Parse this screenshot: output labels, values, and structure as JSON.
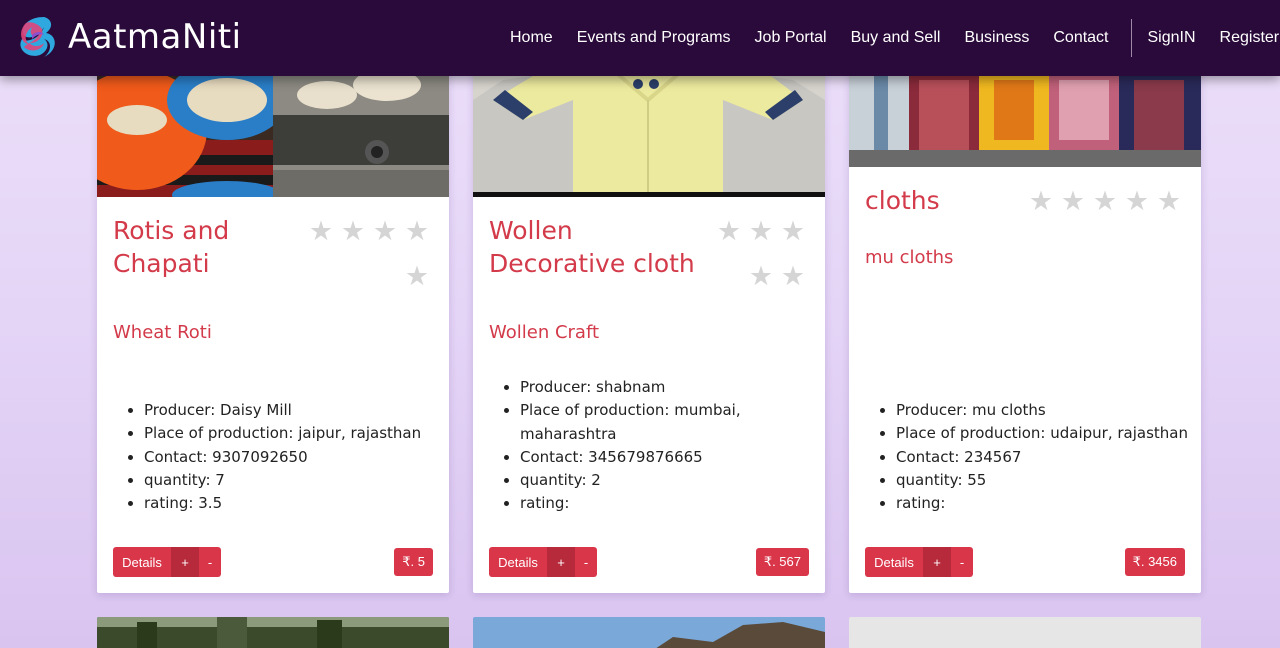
{
  "navbar": {
    "brand": "AatmaNiti",
    "links": [
      "Home",
      "Events and Programs",
      "Job Portal",
      "Buy and Sell",
      "Business",
      "Contact"
    ],
    "auth": [
      "SignIN",
      "Register"
    ]
  },
  "cards": [
    {
      "title_line1": "Rotis and",
      "title_line2": "Chapati",
      "subtitle": "Wheat Roti",
      "producer": "Producer: Daisy Mill",
      "place": "Place of production: jaipur, rajasthan",
      "contact": "Contact: 9307092650",
      "quantity": "quantity: 7",
      "rating": "rating: 3.5",
      "details_label": "Details",
      "plus_label": "+",
      "minus_label": "-",
      "price": "₹. 5",
      "stars": 5
    },
    {
      "title_line1": "Wollen",
      "title_line2": "Decorative cloth",
      "subtitle": "Wollen Craft",
      "producer": "Producer: shabnam",
      "place_line1": "Place of production: mumbai,",
      "place_line2": "maharashtra",
      "contact": "Contact: 345679876665",
      "quantity": "quantity: 2",
      "rating": "rating:",
      "details_label": "Details",
      "plus_label": "+",
      "minus_label": "-",
      "price": "₹. 567",
      "stars": 5
    },
    {
      "title_line1": "cloths",
      "subtitle": "mu cloths",
      "producer": "Producer: mu cloths",
      "place": "Place of production: udaipur, rajasthan",
      "contact": "Contact: 234567",
      "quantity": "quantity: 55",
      "rating": "rating:",
      "details_label": "Details",
      "plus_label": "+",
      "minus_label": "-",
      "price": "₹. 3456",
      "stars": 5
    }
  ],
  "colors": {
    "navbar_bg": "#2a0a3a",
    "accent": "#d9364a",
    "star": "#d5d5d5",
    "page_bg": "#e4d4f6"
  },
  "icons": [
    "brand-logo-icon",
    "star-icon"
  ]
}
